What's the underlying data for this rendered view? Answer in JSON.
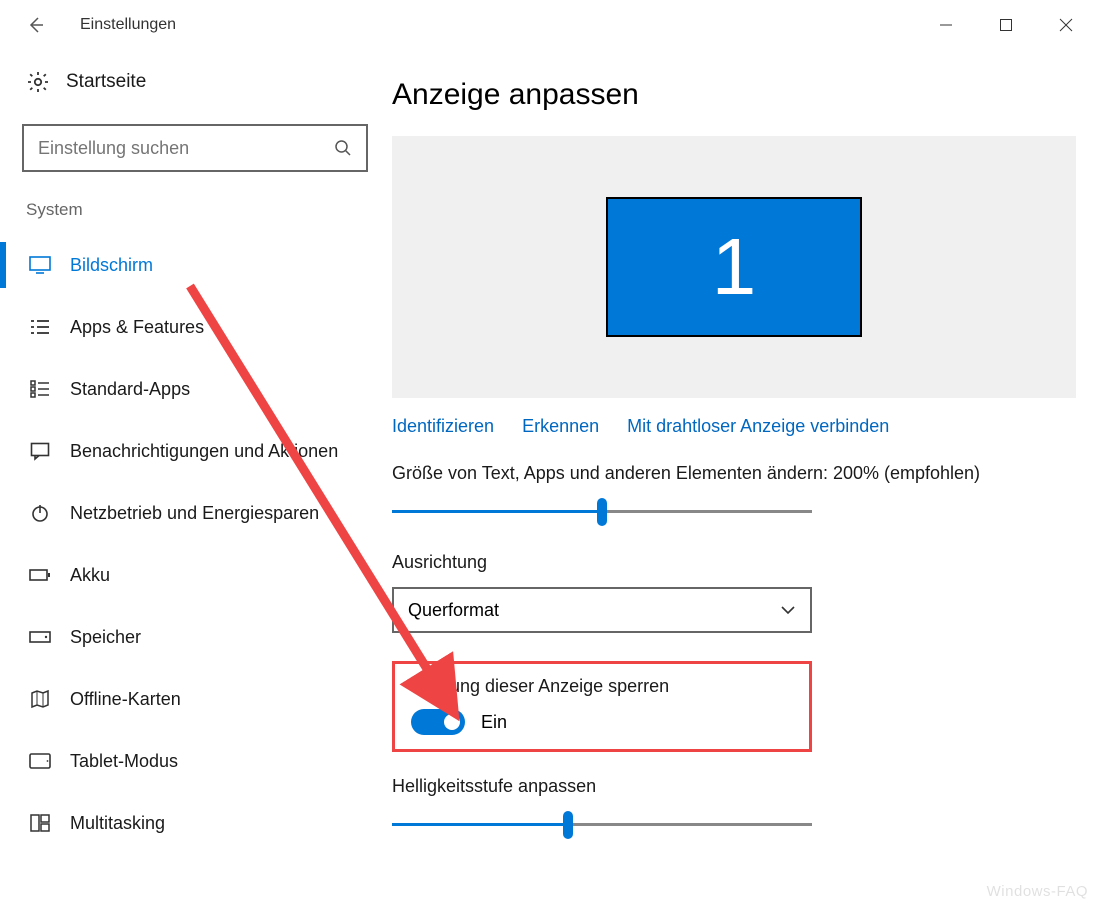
{
  "window": {
    "title": "Einstellungen"
  },
  "sidebar": {
    "home_label": "Startseite",
    "search_placeholder": "Einstellung suchen",
    "section": "System",
    "items": [
      {
        "id": "display",
        "label": "Bildschirm",
        "active": true
      },
      {
        "id": "apps",
        "label": "Apps & Features"
      },
      {
        "id": "default-apps",
        "label": "Standard-Apps"
      },
      {
        "id": "notifications",
        "label": "Benachrichtigungen und Aktionen"
      },
      {
        "id": "power",
        "label": "Netzbetrieb und Energiesparen"
      },
      {
        "id": "battery",
        "label": "Akku"
      },
      {
        "id": "storage",
        "label": "Speicher"
      },
      {
        "id": "maps",
        "label": "Offline-Karten"
      },
      {
        "id": "tablet",
        "label": "Tablet-Modus"
      },
      {
        "id": "multitasking",
        "label": "Multitasking"
      }
    ]
  },
  "main": {
    "heading": "Anzeige anpassen",
    "monitor_number": "1",
    "links": {
      "identify": "Identifizieren",
      "detect": "Erkennen",
      "wireless": "Mit drahtloser Anzeige verbinden"
    },
    "scale_label": "Größe von Text, Apps und anderen Elementen ändern: 200% (empfohlen)",
    "scale_percent": 50,
    "orientation_label": "Ausrichtung",
    "orientation_value": "Querformat",
    "rotation_lock_label": "Drehung dieser Anzeige sperren",
    "rotation_lock_state": "Ein",
    "brightness_label": "Helligkeitsstufe anpassen",
    "brightness_percent": 42
  },
  "watermark": "Windows-FAQ"
}
